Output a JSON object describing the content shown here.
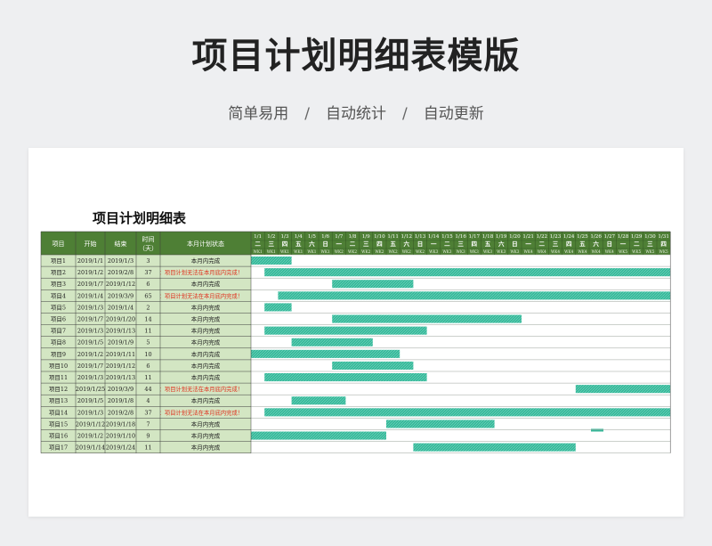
{
  "page": {
    "title": "项目计划明细表模版",
    "subtitle": [
      "简单易用",
      "自动统计",
      "自动更新"
    ],
    "subtitle_sep": "/"
  },
  "sheet": {
    "title": "项目计划明细表",
    "headers": [
      "项目",
      "开始",
      "结束",
      "时间（天）",
      "本月计划状态"
    ],
    "header_time_lines": [
      "时间",
      "（天）"
    ],
    "dates": [
      "1/1",
      "1/2",
      "1/3",
      "1/4",
      "1/5",
      "1/6",
      "1/7",
      "1/8",
      "1/9",
      "1/10",
      "1/11",
      "1/12",
      "1/13",
      "1/14",
      "1/15",
      "1/16",
      "1/17",
      "1/18",
      "1/19",
      "1/20",
      "1/21",
      "1/22",
      "1/23",
      "1/24",
      "1/25",
      "1/26",
      "1/27",
      "1/28",
      "1/29",
      "1/30",
      "1/31"
    ],
    "weekdays": [
      "二",
      "三",
      "四",
      "五",
      "六",
      "日",
      "一",
      "二",
      "三",
      "四",
      "五",
      "六",
      "日",
      "一",
      "二",
      "三",
      "四",
      "五",
      "六",
      "日",
      "一",
      "二",
      "三",
      "四",
      "五",
      "六",
      "日",
      "一",
      "二",
      "三",
      "四"
    ],
    "weeks": [
      "WK1",
      "WK1",
      "WK1",
      "WK1",
      "WK1",
      "WK1",
      "WK2",
      "WK2",
      "WK2",
      "WK2",
      "WK2",
      "WK2",
      "WK2",
      "WK3",
      "WK3",
      "WK3",
      "WK3",
      "WK3",
      "WK3",
      "WK3",
      "WK4",
      "WK4",
      "WK4",
      "WK4",
      "WK4",
      "WK4",
      "WK4",
      "WK5",
      "WK5",
      "WK5",
      "WK5"
    ],
    "colors": {
      "header_bg": "#4e7f35",
      "header_text": "#ffffff",
      "row_bg": "#d3e6c3",
      "bar": "#35b99a",
      "border": "#3c3c3c",
      "warning_text": "#e0301e"
    },
    "rows": [
      {
        "name": "项目1",
        "start": "2019/1/1",
        "end": "2019/1/3",
        "days": "3",
        "status": "本月内完成",
        "warn": false,
        "bar_start": "1/1",
        "bar_end": "1/3"
      },
      {
        "name": "项目2",
        "start": "2019/1/2",
        "end": "2019/2/8",
        "days": "37",
        "status": "提醒：项目计划无法在本月底内完成！",
        "warn": true,
        "bar_start": "1/2",
        "bar_end": "1/31"
      },
      {
        "name": "项目3",
        "start": "2019/1/7",
        "end": "2019/1/12",
        "days": "6",
        "status": "本月内完成",
        "warn": false,
        "bar_start": "1/7",
        "bar_end": "1/12"
      },
      {
        "name": "项目4",
        "start": "2019/1/4",
        "end": "2019/3/9",
        "days": "65",
        "status": "提醒：项目计划无法在本月底内完成！",
        "warn": true,
        "bar_start": "1/3",
        "bar_end": "1/31"
      },
      {
        "name": "项目5",
        "start": "2019/1/3",
        "end": "2019/1/4",
        "days": "2",
        "status": "本月内完成",
        "warn": false,
        "bar_start": "1/2",
        "bar_end": "1/3"
      },
      {
        "name": "项目6",
        "start": "2019/1/7",
        "end": "2019/1/20",
        "days": "14",
        "status": "本月内完成",
        "warn": false,
        "bar_start": "1/7",
        "bar_end": "1/20"
      },
      {
        "name": "项目7",
        "start": "2019/1/3",
        "end": "2019/1/13",
        "days": "11",
        "status": "本月内完成",
        "warn": false,
        "bar_start": "1/2",
        "bar_end": "1/13"
      },
      {
        "name": "项目8",
        "start": "2019/1/5",
        "end": "2019/1/9",
        "days": "5",
        "status": "本月内完成",
        "warn": false,
        "bar_start": "1/4",
        "bar_end": "1/9"
      },
      {
        "name": "项目9",
        "start": "2019/1/2",
        "end": "2019/1/11",
        "days": "10",
        "status": "本月内完成",
        "warn": false,
        "bar_start": "1/1",
        "bar_end": "1/11"
      },
      {
        "name": "项目10",
        "start": "2019/1/7",
        "end": "2019/1/12",
        "days": "6",
        "status": "本月内完成",
        "warn": false,
        "bar_start": "1/7",
        "bar_end": "1/12"
      },
      {
        "name": "项目11",
        "start": "2019/1/3",
        "end": "2019/1/13",
        "days": "11",
        "status": "本月内完成",
        "warn": false,
        "bar_start": "1/2",
        "bar_end": "1/13"
      },
      {
        "name": "项目12",
        "start": "2019/1/25",
        "end": "2019/3/9",
        "days": "44",
        "status": "提醒：项目计划无法在本月底内完成！",
        "warn": true,
        "bar_start": "1/25",
        "bar_end": "1/31"
      },
      {
        "name": "项目13",
        "start": "2019/1/5",
        "end": "2019/1/8",
        "days": "4",
        "status": "本月内完成",
        "warn": false,
        "bar_start": "1/4",
        "bar_end": "1/7"
      },
      {
        "name": "项目14",
        "start": "2019/1/3",
        "end": "2019/2/8",
        "days": "37",
        "status": "提醒：项目计划无法在本月底内完成！",
        "warn": true,
        "bar_start": "1/2",
        "bar_end": "1/31"
      },
      {
        "name": "项目15",
        "start": "2019/1/12",
        "end": "2019/1/18",
        "days": "7",
        "status": "本月内完成",
        "warn": false,
        "bar_start": "1/11",
        "bar_end": "1/18"
      },
      {
        "name": "项目16",
        "start": "2019/1/2",
        "end": "2019/1/10",
        "days": "9",
        "status": "本月内完成",
        "warn": false,
        "bar_start": "1/1",
        "bar_end": "1/10"
      },
      {
        "name": "项目17",
        "start": "2019/1/14",
        "end": "2019/1/24",
        "days": "11",
        "status": "本月内完成",
        "warn": false,
        "bar_start": "1/13",
        "bar_end": "1/24"
      }
    ]
  }
}
